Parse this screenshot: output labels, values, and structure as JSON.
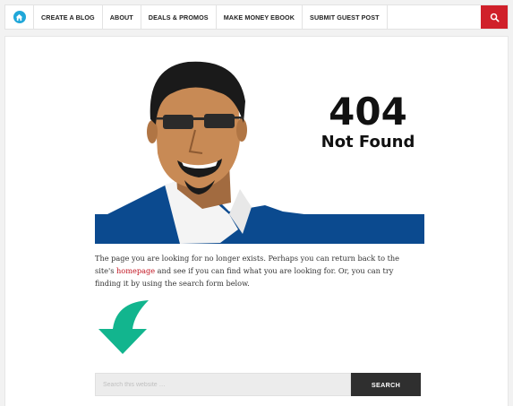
{
  "nav": {
    "home_icon": "home-icon",
    "items": [
      {
        "label": "CREATE A BLOG"
      },
      {
        "label": "ABOUT"
      },
      {
        "label": "DEALS & PROMOS"
      },
      {
        "label": "MAKE MONEY EBOOK"
      },
      {
        "label": "SUBMIT GUEST POST"
      }
    ],
    "search_icon": "search-icon"
  },
  "hero": {
    "code": "404",
    "status": "Not Found"
  },
  "message": {
    "text_before_link": "The page you are looking for no longer exists. Perhaps you can return back to the site's",
    "link_text": "homepage",
    "text_after_link": "and see if you can find what you are looking for. Or, you can try finding it by using the search form below."
  },
  "search": {
    "placeholder": "Search this website …",
    "button_label": "SEARCH"
  },
  "colors": {
    "accent_red": "#d0202a",
    "link_red": "#c1121f",
    "hero_blue": "#0b4a8f",
    "arrow_teal": "#12b58e"
  }
}
